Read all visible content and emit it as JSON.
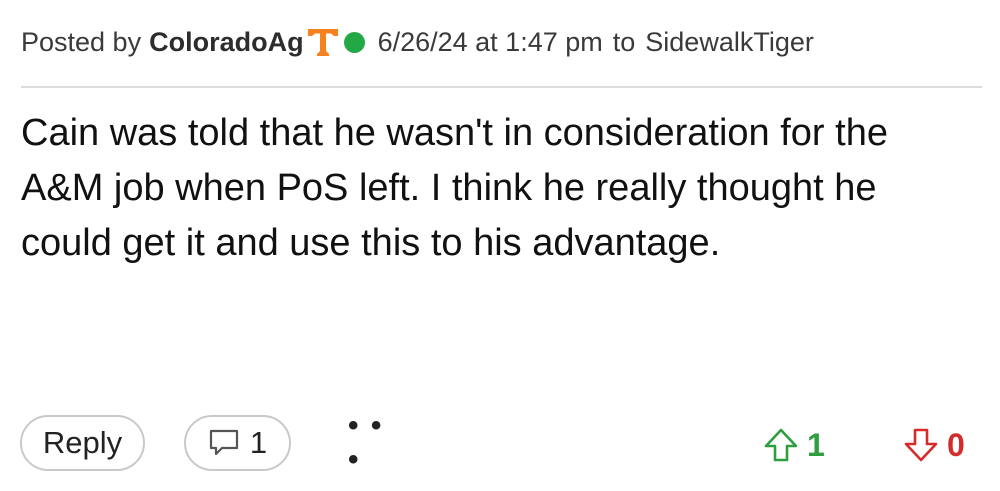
{
  "header": {
    "posted_by_label": "Posted by",
    "author": "ColoradoAg",
    "team_logo_icon": "tennessee-t-logo",
    "team_logo_color": "#f5821f",
    "online_status_color": "#22a845",
    "timestamp": "6/26/24 at 1:47 pm",
    "to_label": "to",
    "recipient": "SidewalkTiger"
  },
  "body": {
    "text": "Cain was told that he wasn't in consideration for the A&M job when PoS left. I think he really thought he could get it and use this to his advantage."
  },
  "actions": {
    "reply_label": "Reply",
    "comment_icon": "comment-icon",
    "comment_count": "1",
    "more_label": "• • •",
    "upvote_icon": "up-arrow-icon",
    "upvote_count": "1",
    "upvote_color": "#2e9e3f",
    "downvote_icon": "down-arrow-icon",
    "downvote_count": "0",
    "downvote_color": "#d62b2b"
  }
}
